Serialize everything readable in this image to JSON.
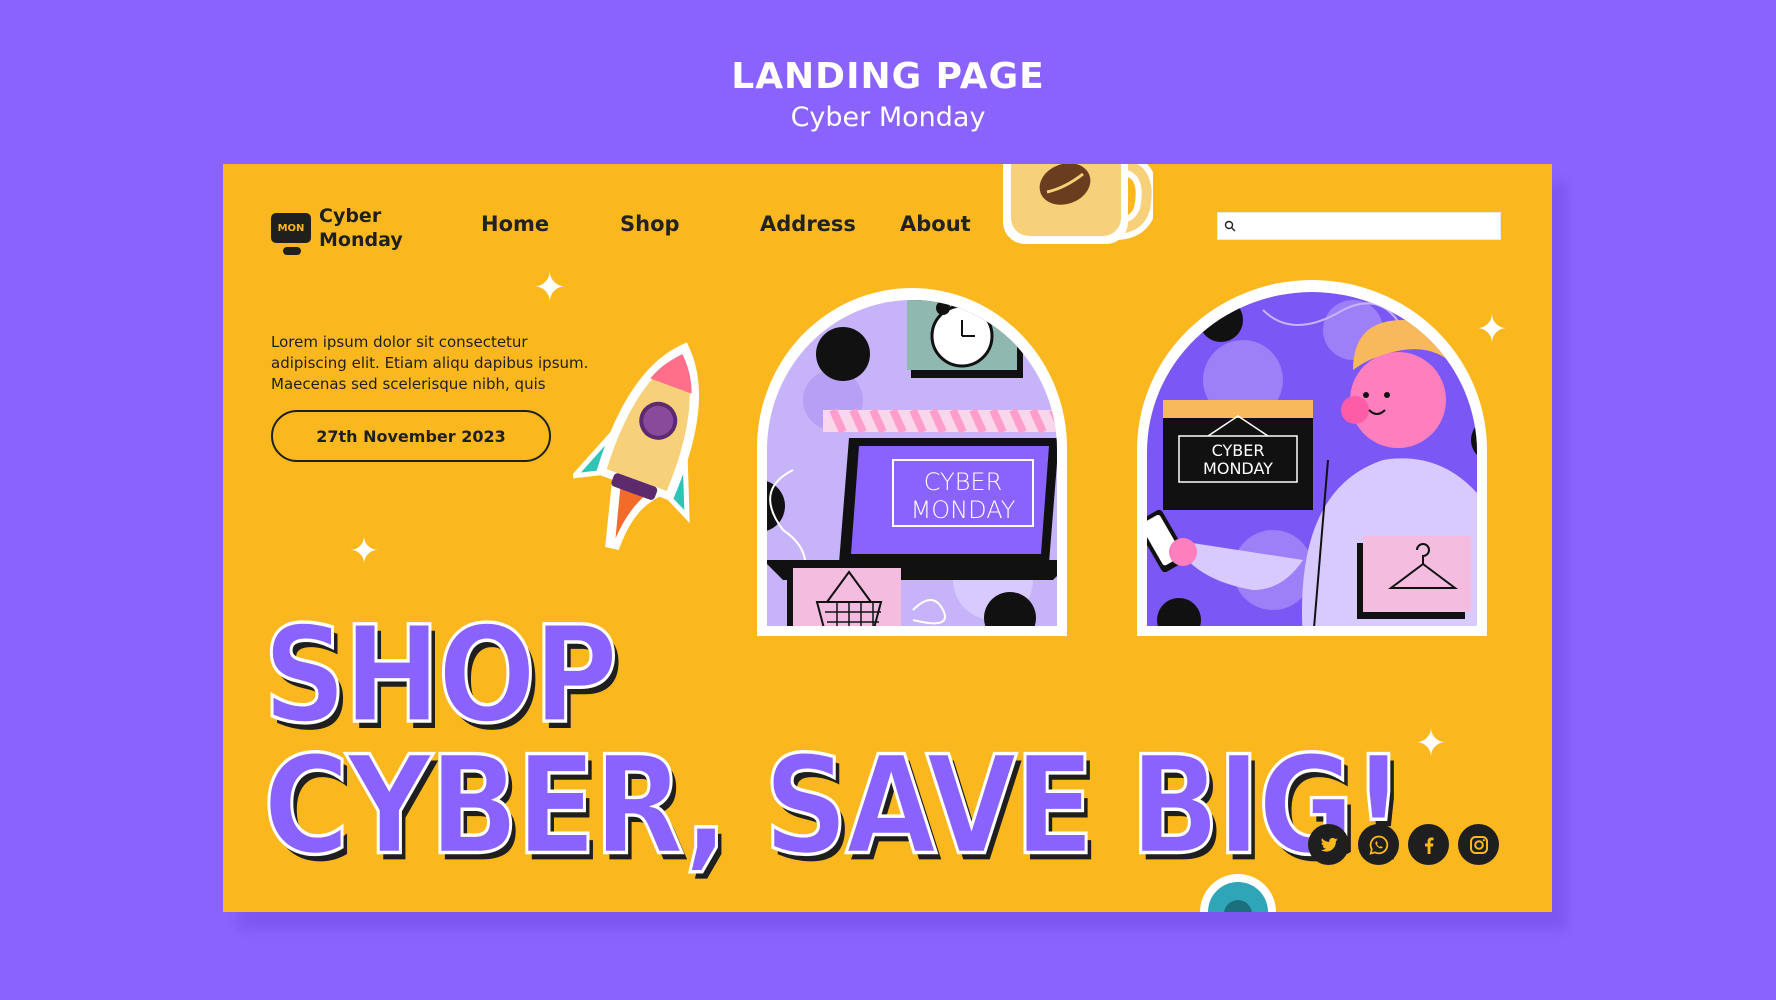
{
  "header": {
    "title": "LANDING PAGE",
    "subtitle": "Cyber Monday"
  },
  "logo": {
    "badge": "MON",
    "line1": "Cyber",
    "line2": "Monday"
  },
  "nav": {
    "items": [
      "Home",
      "Shop",
      "Address",
      "About"
    ]
  },
  "search": {
    "placeholder": "",
    "icon": "search-icon"
  },
  "intro": {
    "text": "Lorem ipsum dolor sit consectetur adipiscing elit. Etiam aliqu dapibus ipsum. Maecenas sed scelerisque nibh, quis"
  },
  "cta": {
    "label": "27th November 2023"
  },
  "headline": {
    "line1": "SHOP",
    "line2": "CYBER, SAVE BIG!"
  },
  "illustration": {
    "laptop_sign": "CYBER MONDAY",
    "shop_sign": "CYBER MONDAY"
  },
  "socials": [
    "twitter-icon",
    "whatsapp-icon",
    "facebook-icon",
    "instagram-icon"
  ],
  "colors": {
    "background": "#8a63ff",
    "page": "#fbb81e",
    "accent": "#8a63ff",
    "dark": "#1f1f1f"
  }
}
